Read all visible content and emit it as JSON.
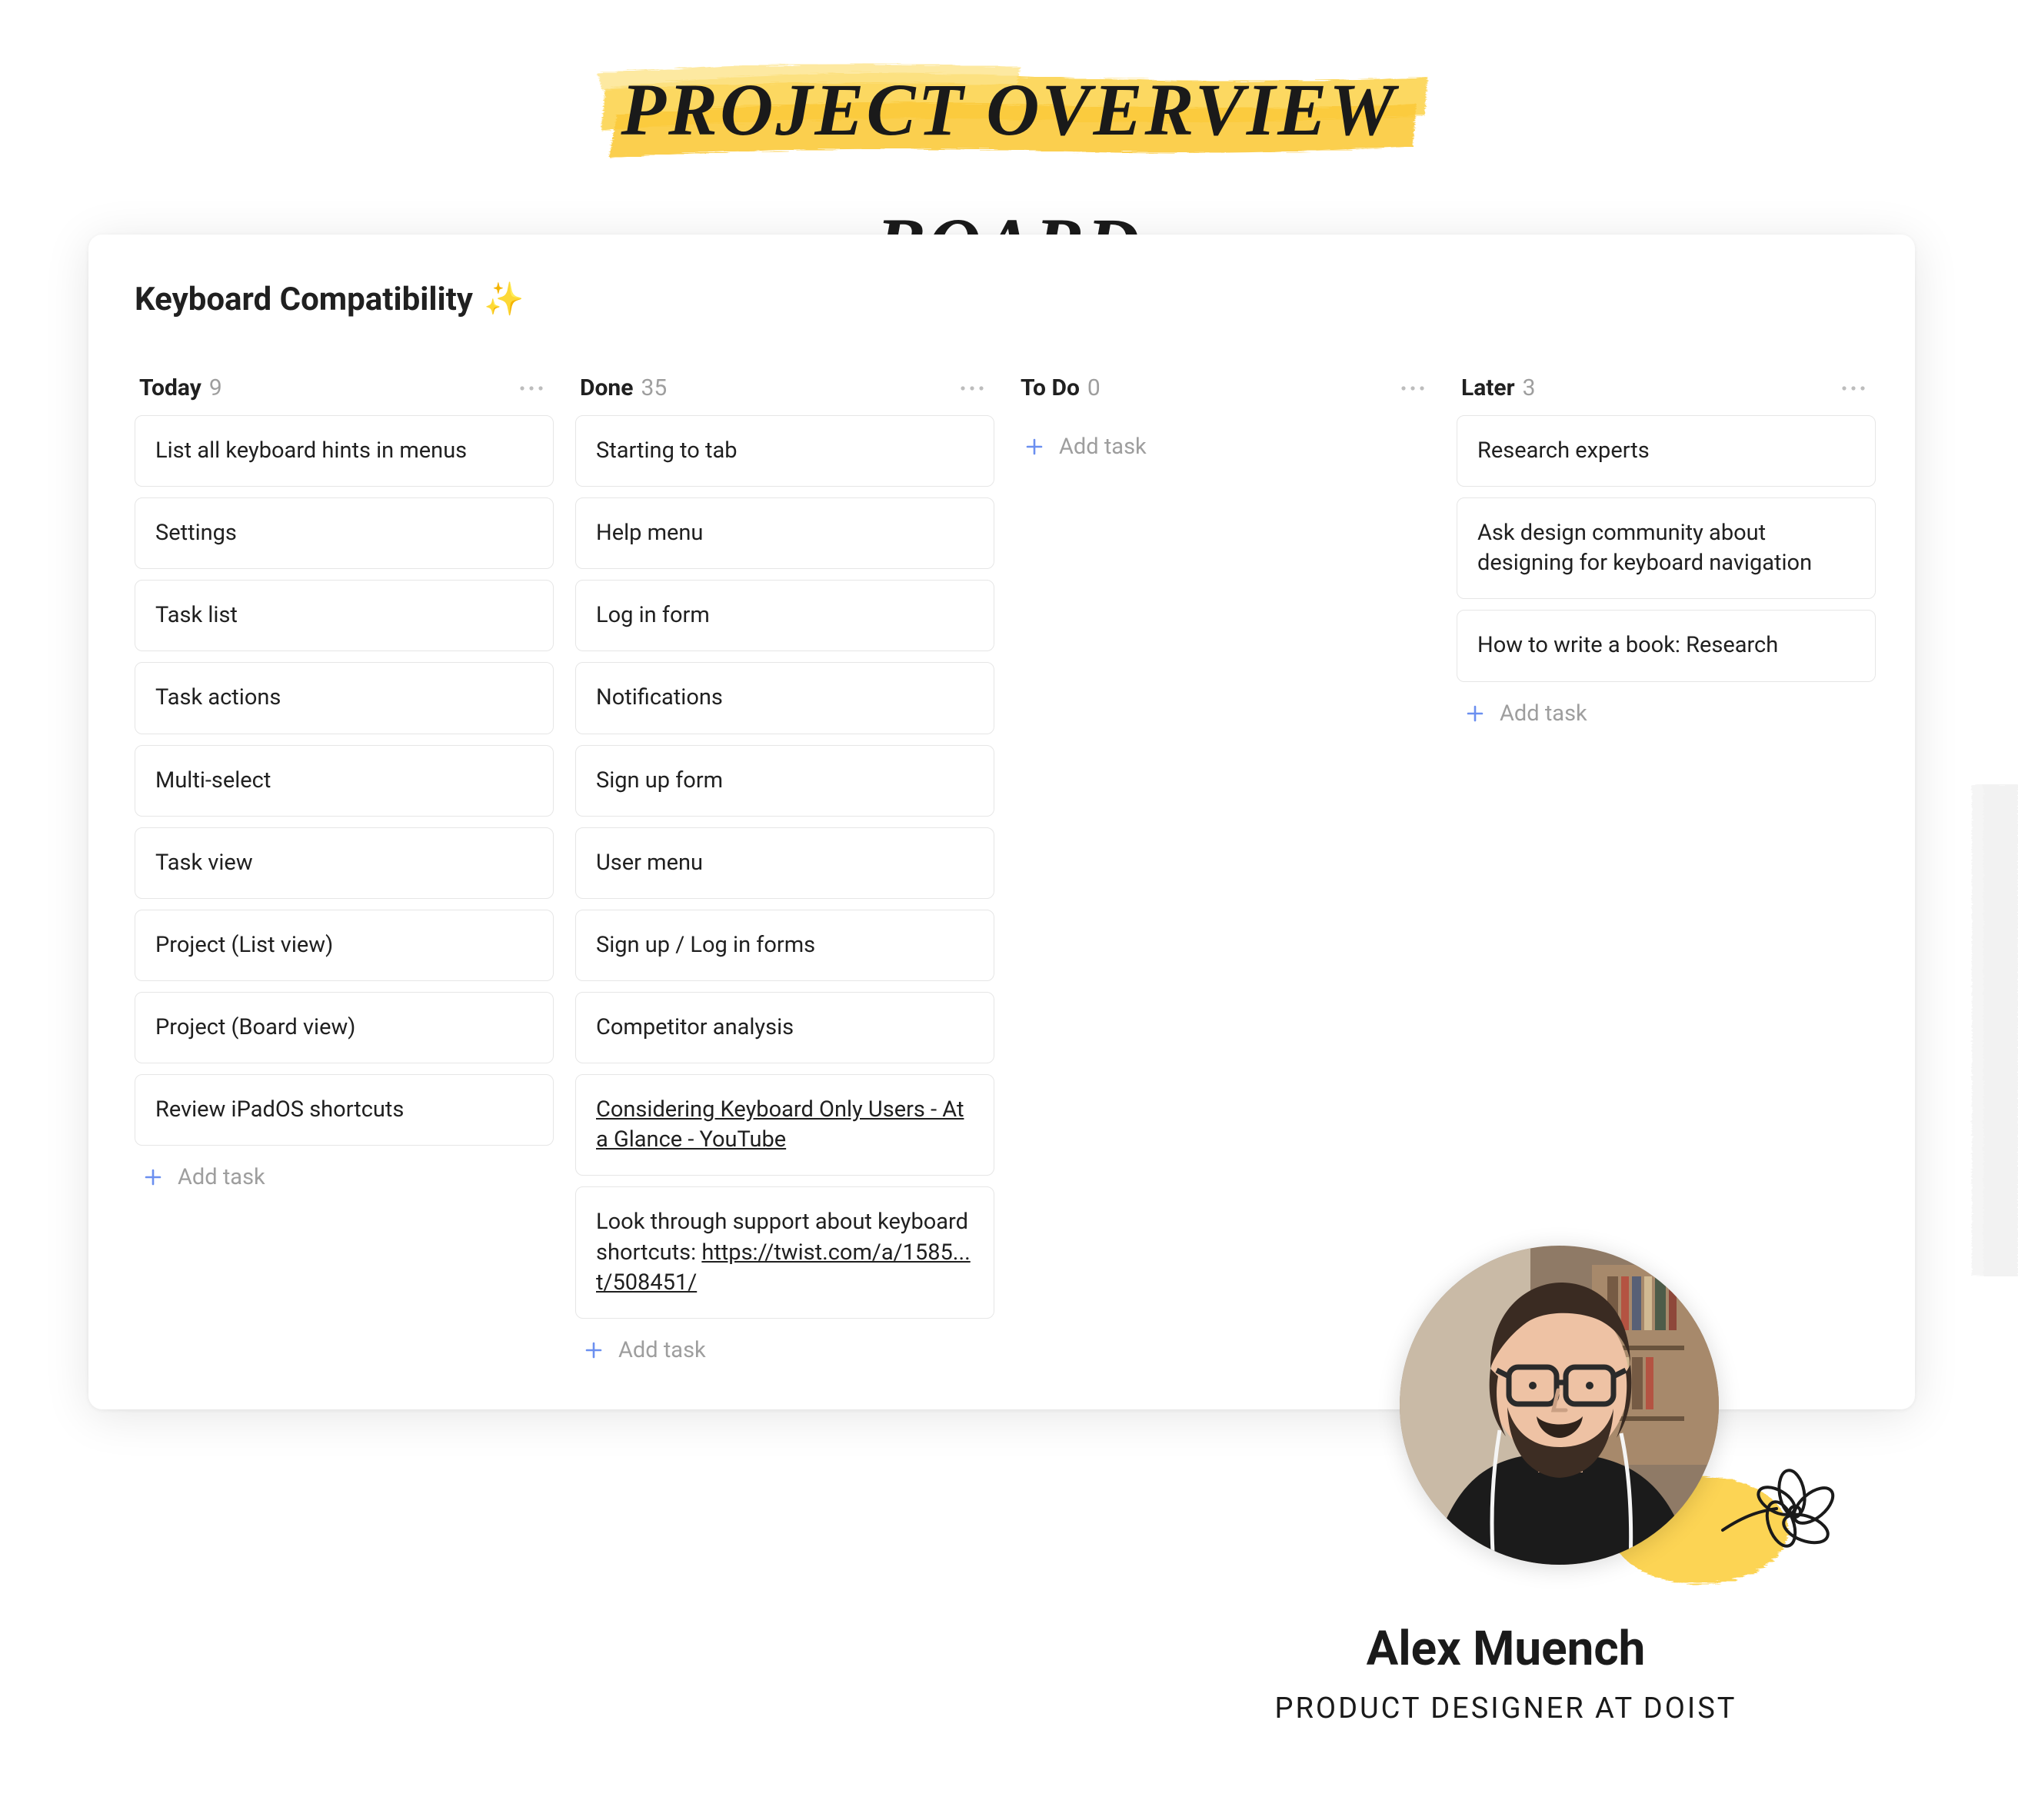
{
  "header": {
    "title": "PROJECT OVERVIEW BOARD"
  },
  "project": {
    "title": "Keyboard Compatibility",
    "emoji": "✨"
  },
  "add_task_label": "Add task",
  "columns": [
    {
      "name": "Today",
      "count": "9",
      "tasks": [
        {
          "text": "List all keyboard hints in menus"
        },
        {
          "text": "Settings"
        },
        {
          "text": "Task list"
        },
        {
          "text": "Task actions"
        },
        {
          "text": "Multi-select"
        },
        {
          "text": "Task view"
        },
        {
          "text": "Project (List view)"
        },
        {
          "text": "Project (Board view)"
        },
        {
          "text": "Review iPadOS shortcuts"
        }
      ],
      "show_add": true
    },
    {
      "name": "Done",
      "count": "35",
      "tasks": [
        {
          "text": "Starting to tab"
        },
        {
          "text": "Help menu"
        },
        {
          "text": "Log in form"
        },
        {
          "text": "Notifications"
        },
        {
          "text": "Sign up form"
        },
        {
          "text": "User menu"
        },
        {
          "text": "Sign up / Log in forms"
        },
        {
          "text": "Competitor analysis"
        },
        {
          "text": "Considering Keyboard Only Users - At a Glance - YouTube",
          "underline": true
        },
        {
          "text_prefix": "Look through support about keyboard shortcuts: ",
          "link": "https://twist.com/a/1585... t/508451/"
        }
      ],
      "show_add": true
    },
    {
      "name": "To Do",
      "count": "0",
      "tasks": [],
      "show_add": true
    },
    {
      "name": "Later",
      "count": "3",
      "tasks": [
        {
          "text": "Research experts"
        },
        {
          "text": "Ask design community about designing for keyboard navigation"
        },
        {
          "text": "How to write a book: Research"
        }
      ],
      "show_add": true
    }
  ],
  "person": {
    "name": "Alex Muench",
    "role": "Product Designer at Doist"
  },
  "colors": {
    "highlight": "#fbd34d",
    "plus": "#6b8ff0"
  }
}
